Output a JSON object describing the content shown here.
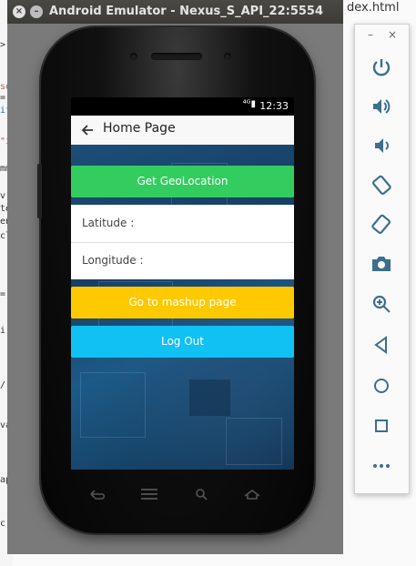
{
  "background_ide": {
    "file_tab": "dex.html",
    "gutter_fragments": [
      ">",
      "se",
      "=",
      "if",
      "\"i",
      "mm",
      "v",
      "te",
      "en",
      "cl",
      "=",
      "i",
      "/",
      "va",
      "ap",
      "c"
    ]
  },
  "emulator": {
    "window_title": "Android Emulator - Nexus_S_API_22:5554",
    "close_label": "×",
    "minimize_label": "–"
  },
  "status_bar": {
    "icons": "⁴ᴳ▮",
    "time": "12:33"
  },
  "app": {
    "title": "Home Page",
    "buttons": {
      "geolocation": "Get GeoLocation",
      "mashup": "Go to mashup page",
      "logout": "Log Out"
    },
    "fields": {
      "latitude": "Latitude :",
      "longitude": "Longitude :"
    },
    "colors": {
      "geolocation": "#33cd5f",
      "mashup": "#ffc900",
      "logout": "#11c1f3"
    }
  },
  "side_panel": {
    "minimize": "–",
    "close": "×",
    "tools": [
      "power-icon",
      "volume-up-icon",
      "volume-down-icon",
      "rotate-left-icon",
      "rotate-right-icon",
      "camera-icon",
      "zoom-icon",
      "back-icon",
      "home-icon",
      "overview-icon",
      "more-icon"
    ]
  }
}
